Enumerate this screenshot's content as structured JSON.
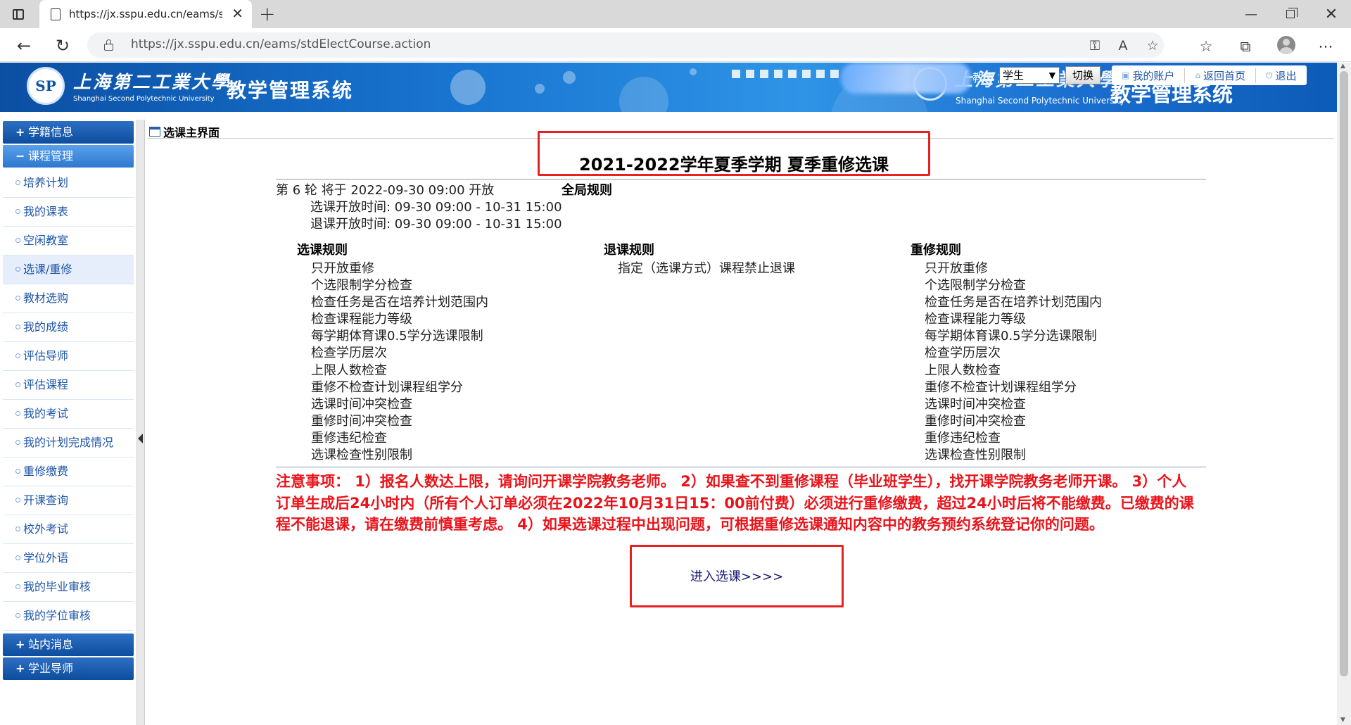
{
  "browser": {
    "tab_title": "https://jx.sspu.edu.cn/eams/stdE",
    "url": "https://jx.sspu.edu.cn/eams/stdElectCourse.action"
  },
  "banner": {
    "school_name_cn": "上海第二工業大學",
    "school_name_en": "Shanghai Second Polytechnic University",
    "system_name": "教学管理系统",
    "role_label": "教学",
    "role_value": "学生",
    "switch_label": "切换",
    "account_label": "我的账户",
    "home_label": "返回首页",
    "logout_label": "退出"
  },
  "sidebar": {
    "groups": [
      {
        "label": "学籍信息",
        "sign": "+"
      },
      {
        "label": "课程管理",
        "sign": "−"
      },
      {
        "label": "站内消息",
        "sign": "+"
      },
      {
        "label": "学业导师",
        "sign": "+"
      }
    ],
    "items": [
      {
        "label": "培养计划"
      },
      {
        "label": "我的课表"
      },
      {
        "label": "空闲教室"
      },
      {
        "label": "选课/重修"
      },
      {
        "label": "教材选购"
      },
      {
        "label": "我的成绩"
      },
      {
        "label": "评估导师"
      },
      {
        "label": "评估课程"
      },
      {
        "label": "我的考试"
      },
      {
        "label": "我的计划完成情况"
      },
      {
        "label": "重修缴费"
      },
      {
        "label": "开课查询"
      },
      {
        "label": "校外考试"
      },
      {
        "label": "学位外语"
      },
      {
        "label": "我的毕业审核"
      },
      {
        "label": "我的学位审核"
      }
    ]
  },
  "main": {
    "breadcrumb": "选课主界面",
    "title": "2021-2022学年夏季学期 夏季重修选课",
    "round_info": "第 6 轮 将于 2022-09-30 09:00 开放",
    "elect_open": "选课开放时间: 09-30 09:00 - 10-31 15:00",
    "drop_open": "退课开放时间: 09-30 09:00 - 10-31 15:00",
    "global_rules": "全局规则",
    "elect_rules_title": "选课规则",
    "drop_rules_title": "退课规则",
    "retake_rules_title": "重修规则",
    "elect_rules": [
      "只开放重修",
      "个选限制学分检查",
      "检查任务是否在培养计划范围内",
      "检查课程能力等级",
      "每学期体育课0.5学分选课限制",
      "检查学历层次",
      "上限人数检查",
      "重修不检查计划课程组学分",
      "选课时间冲突检查",
      "重修时间冲突检查",
      "重修违纪检查",
      "选课检查性别限制"
    ],
    "drop_rules": [
      "指定（选课方式）课程禁止退课"
    ],
    "retake_rules": [
      "只开放重修",
      "个选限制学分检查",
      "检查任务是否在培养计划范围内",
      "检查课程能力等级",
      "每学期体育课0.5学分选课限制",
      "检查学历层次",
      "上限人数检查",
      "重修不检查计划课程组学分",
      "选课时间冲突检查",
      "重修时间冲突检查",
      "重修违纪检查",
      "选课检查性别限制"
    ],
    "notice": "注意事项： 1）报名人数达上限，请询问开课学院教务老师。 2）如果查不到重修课程（毕业班学生），找开课学院教务老师开课。 3）个人订单生成后24小时内（所有个人订单必须在2022年10月31日15：00前付费）必须进行重修缴费，超过24小时后将不能缴费。已缴费的课程不能退课，请在缴费前慎重考虑。 4）如果选课过程中出现问题，可根据重修选课通知内容中的教务预约系统登记你的问题。",
    "enter_label": "进入选课>>>>"
  },
  "colors": {
    "banner_blue": "#0b4fa3",
    "highlight_red": "#e82020",
    "notice_red": "#e8141b",
    "link_blue": "#1d55a8"
  }
}
